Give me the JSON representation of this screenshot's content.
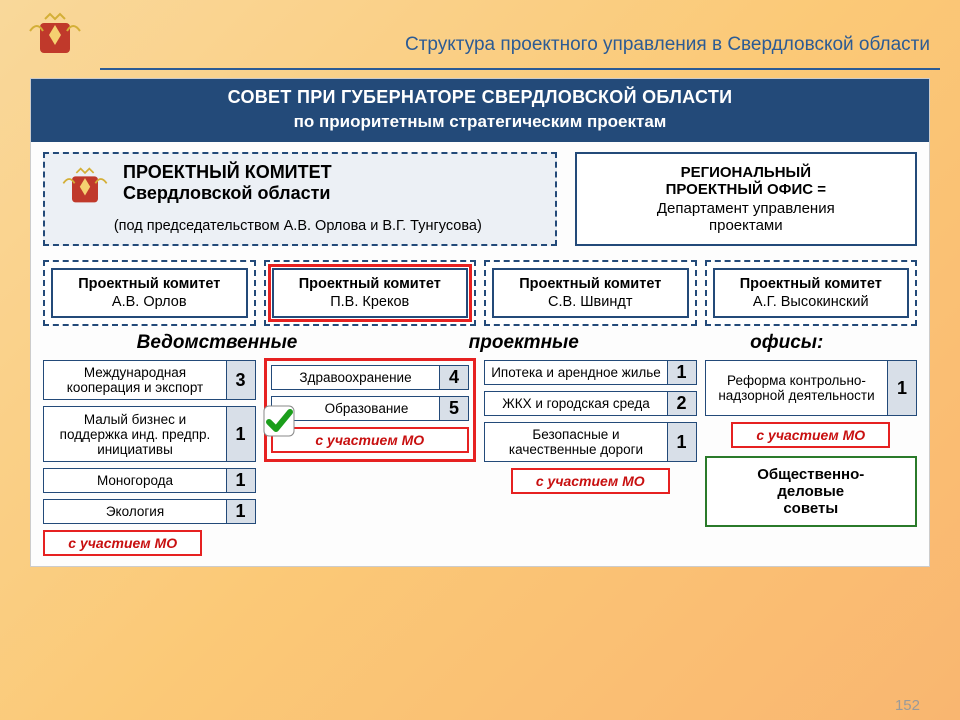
{
  "page": {
    "title": "Структура проектного управления в Свердловской области",
    "number": "152"
  },
  "council": {
    "line1": "СОВЕТ ПРИ ГУБЕРНАТОРЕ СВЕРДЛОВСКОЙ ОБЛАСТИ",
    "line2": "по приоритетным стратегическим проектам"
  },
  "main_committee": {
    "line1": "ПРОЕКТНЫЙ КОМИТЕТ",
    "line2": "Свердловской области",
    "sub": "(под председательством А.В. Орлова и  В.Г. Тунгусова)"
  },
  "regional_office": {
    "l1": "РЕГИОНАЛЬНЫЙ",
    "l2": "ПРОЕКТНЫЙ ОФИС =",
    "l3": "Департамент управления",
    "l4": "проектами"
  },
  "pcs": [
    {
      "title": "Проектный комитет",
      "name": "А.В. Орлов"
    },
    {
      "title": "Проектный комитет",
      "name": "П.В. Креков"
    },
    {
      "title": "Проектный комитет",
      "name": "С.В. Швиндт"
    },
    {
      "title": "Проектный комитет",
      "name": "А.Г. Высокинский"
    }
  ],
  "subtitle": {
    "w1": "Ведомственные",
    "w2": "проектные",
    "w3": "офисы:"
  },
  "col1": [
    {
      "label": "Международная кооперация и экспорт",
      "num": "3"
    },
    {
      "label": "Малый бизнес и поддержка инд. предпр. инициативы",
      "num": "1"
    },
    {
      "label": "Моногорода",
      "num": "1"
    },
    {
      "label": "Экология",
      "num": "1"
    }
  ],
  "col2": [
    {
      "label": "Здравоохранение",
      "num": "4"
    },
    {
      "label": "Образование",
      "num": "5"
    }
  ],
  "col3": [
    {
      "label": "Ипотека и арендное жилье",
      "num": "1"
    },
    {
      "label": "ЖКХ и городская среда",
      "num": "2"
    },
    {
      "label": "Безопасные и качественные дороги",
      "num": "1"
    }
  ],
  "col4": [
    {
      "label": "Реформа контрольно-надзорной деятельности",
      "num": "1"
    }
  ],
  "mo_note": "с участием МО",
  "business": {
    "l1": "Общественно-",
    "l2": "деловые",
    "l3": "советы"
  }
}
